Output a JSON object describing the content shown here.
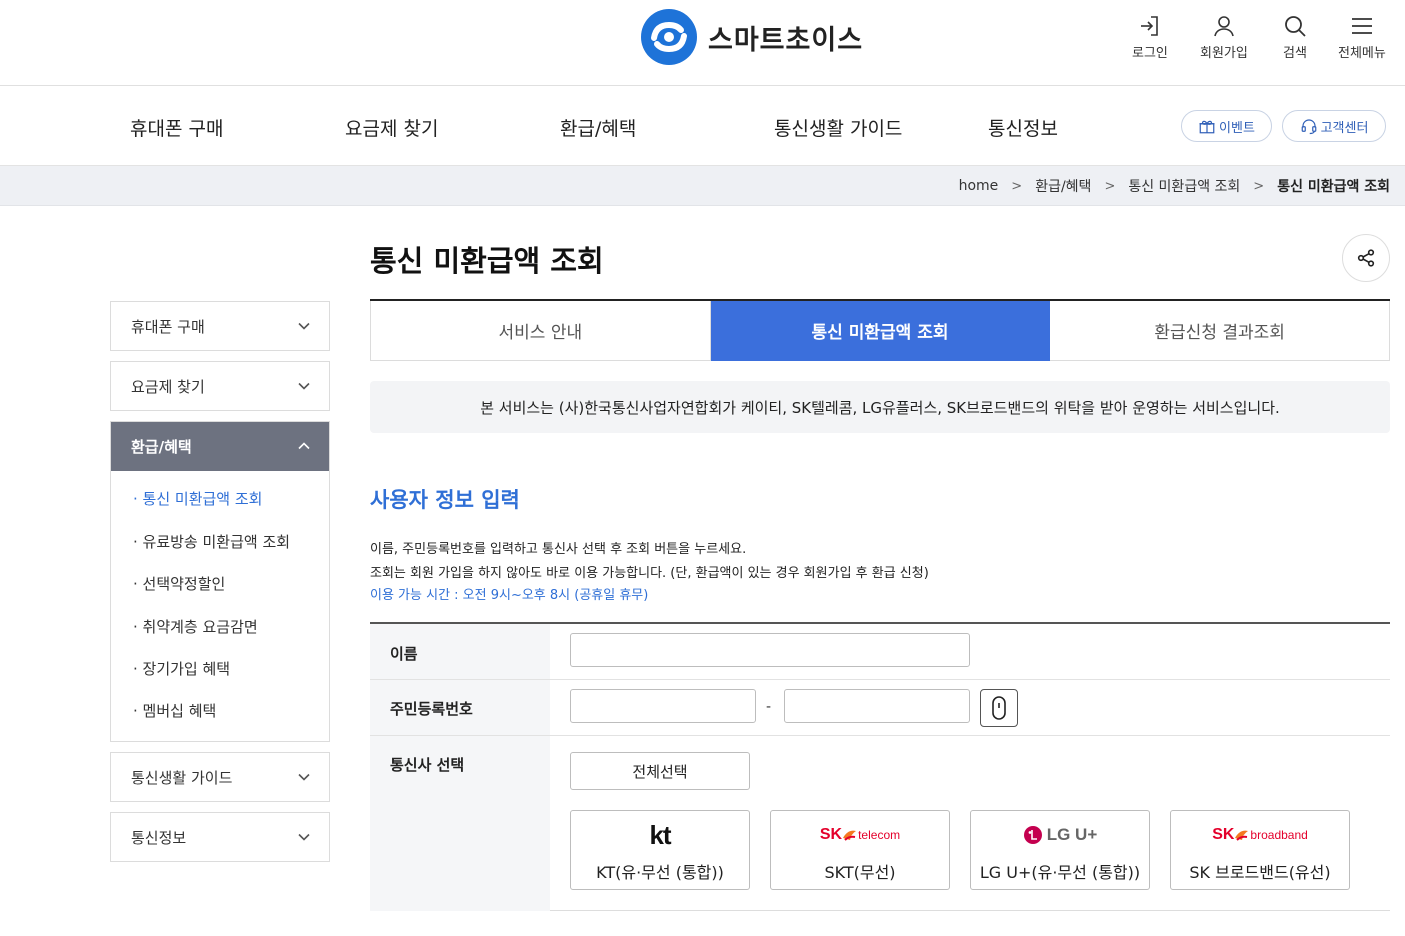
{
  "header": {
    "logo_text": "스마트초이스",
    "utils": [
      {
        "label": "로그인",
        "icon": "login-icon"
      },
      {
        "label": "회원가입",
        "icon": "user-icon"
      },
      {
        "label": "검색",
        "icon": "search-icon"
      },
      {
        "label": "전체메뉴",
        "icon": "menu-icon"
      }
    ]
  },
  "gnb": {
    "items": [
      "휴대폰 구매",
      "요금제 찾기",
      "환급/혜택",
      "통신생활 가이드",
      "통신정보"
    ],
    "event_label": "이벤트",
    "support_label": "고객센터"
  },
  "breadcrumb": [
    "home",
    "환급/혜택",
    "통신 미환급액 조회",
    "통신 미환급액 조회"
  ],
  "sidebar": {
    "items": [
      "휴대폰 구매",
      "요금제 찾기",
      "환급/혜택",
      "통신생활 가이드",
      "통신정보"
    ],
    "subitems": [
      "· 통신 미환급액 조회",
      "· 유료방송 미환급액 조회",
      "· 선택약정할인",
      "· 취약계층 요금감면",
      "· 장기가입 혜택",
      "· 멤버십 혜택"
    ]
  },
  "main": {
    "title": "통신 미환급액 조회",
    "tabs": [
      "서비스 안내",
      "통신 미환급액 조회",
      "환급신청 결과조회"
    ],
    "notice": "본 서비스는 (사)한국통신사업자연합회가 케이티, SK텔레콤, LG유플러스, SK브로드밴드의 위탁을 받아 운영하는 서비스입니다.",
    "section_title": "사용자 정보 입력",
    "desc": [
      "이름, 주민등록번호를 입력하고 통신사 선택 후 조회 버튼을 누르세요.",
      "조회는 회원 가입을 하지 않아도 바로 이용 가능합니다. (단, 환급액이 있는 경우 회원가입 후 환급 신청)",
      "이용 가능 시간 : 오전 9시~오후 8시 (공휴일 휴무)"
    ]
  },
  "form": {
    "name_label": "이름",
    "rrn_label": "주민등록번호",
    "rrn_dash": "-",
    "carrier_label": "통신사 선택",
    "select_all": "전체선택",
    "carriers": [
      {
        "name": "KT(유·무선 (통합))",
        "logo": "kt"
      },
      {
        "name": "SKT(무선)",
        "logo": "SK",
        "logo_sub": "telecom"
      },
      {
        "name": "LG U+(유·무선 (통합))",
        "logo": "LG U+"
      },
      {
        "name": "SK 브로드밴드(유선)",
        "logo": "SK",
        "logo_sub": "broadband"
      }
    ]
  },
  "colors": {
    "accent": "#3b6fdc",
    "link": "#2f6fd6",
    "sidebar_active": "#6d7280",
    "kt_red": "#e4002b",
    "lg_magenta": "#c4004f",
    "sk_red": "#e4002b",
    "sk_orange": "#f47920"
  }
}
